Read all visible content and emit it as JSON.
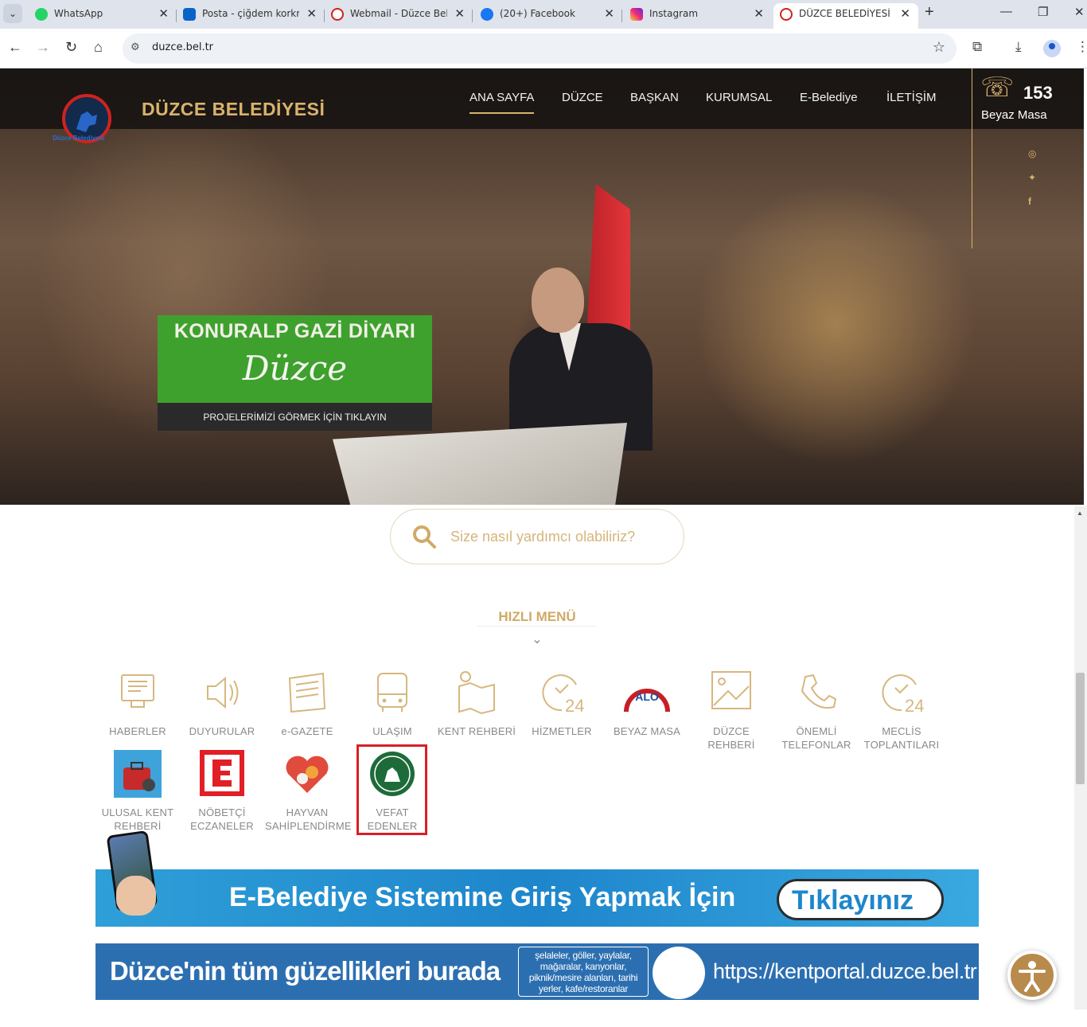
{
  "browser": {
    "tabs": [
      {
        "title": "WhatsApp",
        "favicon_color": "#25d366"
      },
      {
        "title": "Posta - çiğdem korkmaz",
        "favicon_color": "#0a64c8"
      },
      {
        "title": "Webmail - Düzce Belediyesi",
        "favicon_color": "#d0231e"
      },
      {
        "title": "(20+) Facebook",
        "favicon_color": "#1877f2"
      },
      {
        "title": "Instagram",
        "favicon_color": "#e1306c"
      },
      {
        "title": "DÜZCE BELEDİYESİ",
        "favicon_color": "#d0231e"
      }
    ],
    "url": "duzce.bel.tr"
  },
  "header": {
    "logo_caption": "Düzce Belediyesi",
    "site_title": "DÜZCE BELEDİYESİ",
    "menu": [
      "ANA SAYFA",
      "DÜZCE",
      "BAŞKAN",
      "KURUMSAL",
      "E-Belediye",
      "İLETİŞİM"
    ],
    "active_menu": "ANA SAYFA",
    "hotline_number": "153",
    "hotline_label": "Beyaz Masa",
    "social_icons": [
      "instagram-icon",
      "twitter-icon",
      "facebook-icon"
    ]
  },
  "hero": {
    "promo_title": "KONURALP GAZİ DİYARI",
    "promo_script": "Düzce",
    "promo_cta": "PROJELERİMİZİ GÖRMEK İÇİN TIKLAYIN"
  },
  "search": {
    "placeholder": "Size nasıl yardımcı olabiliriz?"
  },
  "quick_menu": {
    "title": "HIZLI MENÜ",
    "items": [
      {
        "l1": "HABERLER",
        "l2": "",
        "icon": "news-computer-icon"
      },
      {
        "l1": "DUYURULAR",
        "l2": "",
        "icon": "speaker-icon"
      },
      {
        "l1": "e-GAZETE",
        "l2": "",
        "icon": "newspaper-icon"
      },
      {
        "l1": "ULAŞIM",
        "l2": "",
        "icon": "bus-icon"
      },
      {
        "l1": "KENT REHBERİ",
        "l2": "",
        "icon": "map-pin-icon"
      },
      {
        "l1": "HİZMETLER",
        "l2": "",
        "icon": "clock-24-icon"
      },
      {
        "l1": "BEYAZ MASA",
        "l2": "",
        "icon": "beyaz-masa-alo-icon"
      },
      {
        "l1": "DÜZCE",
        "l2": "REHBERİ",
        "icon": "image-icon"
      },
      {
        "l1": "ÖNEMLİ",
        "l2": "TELEFONLAR",
        "icon": "phone-icon"
      },
      {
        "l1": "MECLİS",
        "l2": "TOPLANTILARI",
        "icon": "clock-24-icon"
      },
      {
        "l1": "ULUSAL KENT",
        "l2": "REHBERİ",
        "icon": "suitcase-travel-icon"
      },
      {
        "l1": "NÖBETÇİ",
        "l2": "ECZANELER",
        "icon": "pharmacy-e-icon"
      },
      {
        "l1": "HAYVAN",
        "l2": "SAHİPLENDİRME",
        "icon": "pet-heart-icon"
      },
      {
        "l1": "VEFAT",
        "l2": "EDENLER",
        "icon": "cemetery-seal-icon"
      }
    ],
    "highlighted": "VEFAT EDENLER"
  },
  "banners": {
    "ebelediye_text": "E-Belediye Sistemine Giriş Yapmak İçin",
    "ebelediye_button": "Tıklayınız",
    "kent_text": "Düzce'nin tüm güzellikleri burada",
    "kent_box": "şelaleler, göller, yaylalar, mağaralar, kanyonlar, piknik/mesire alanları, tarihi yerler, kafe/restoranlar",
    "kent_url": "https://kentportal.duzce.bel.tr"
  }
}
